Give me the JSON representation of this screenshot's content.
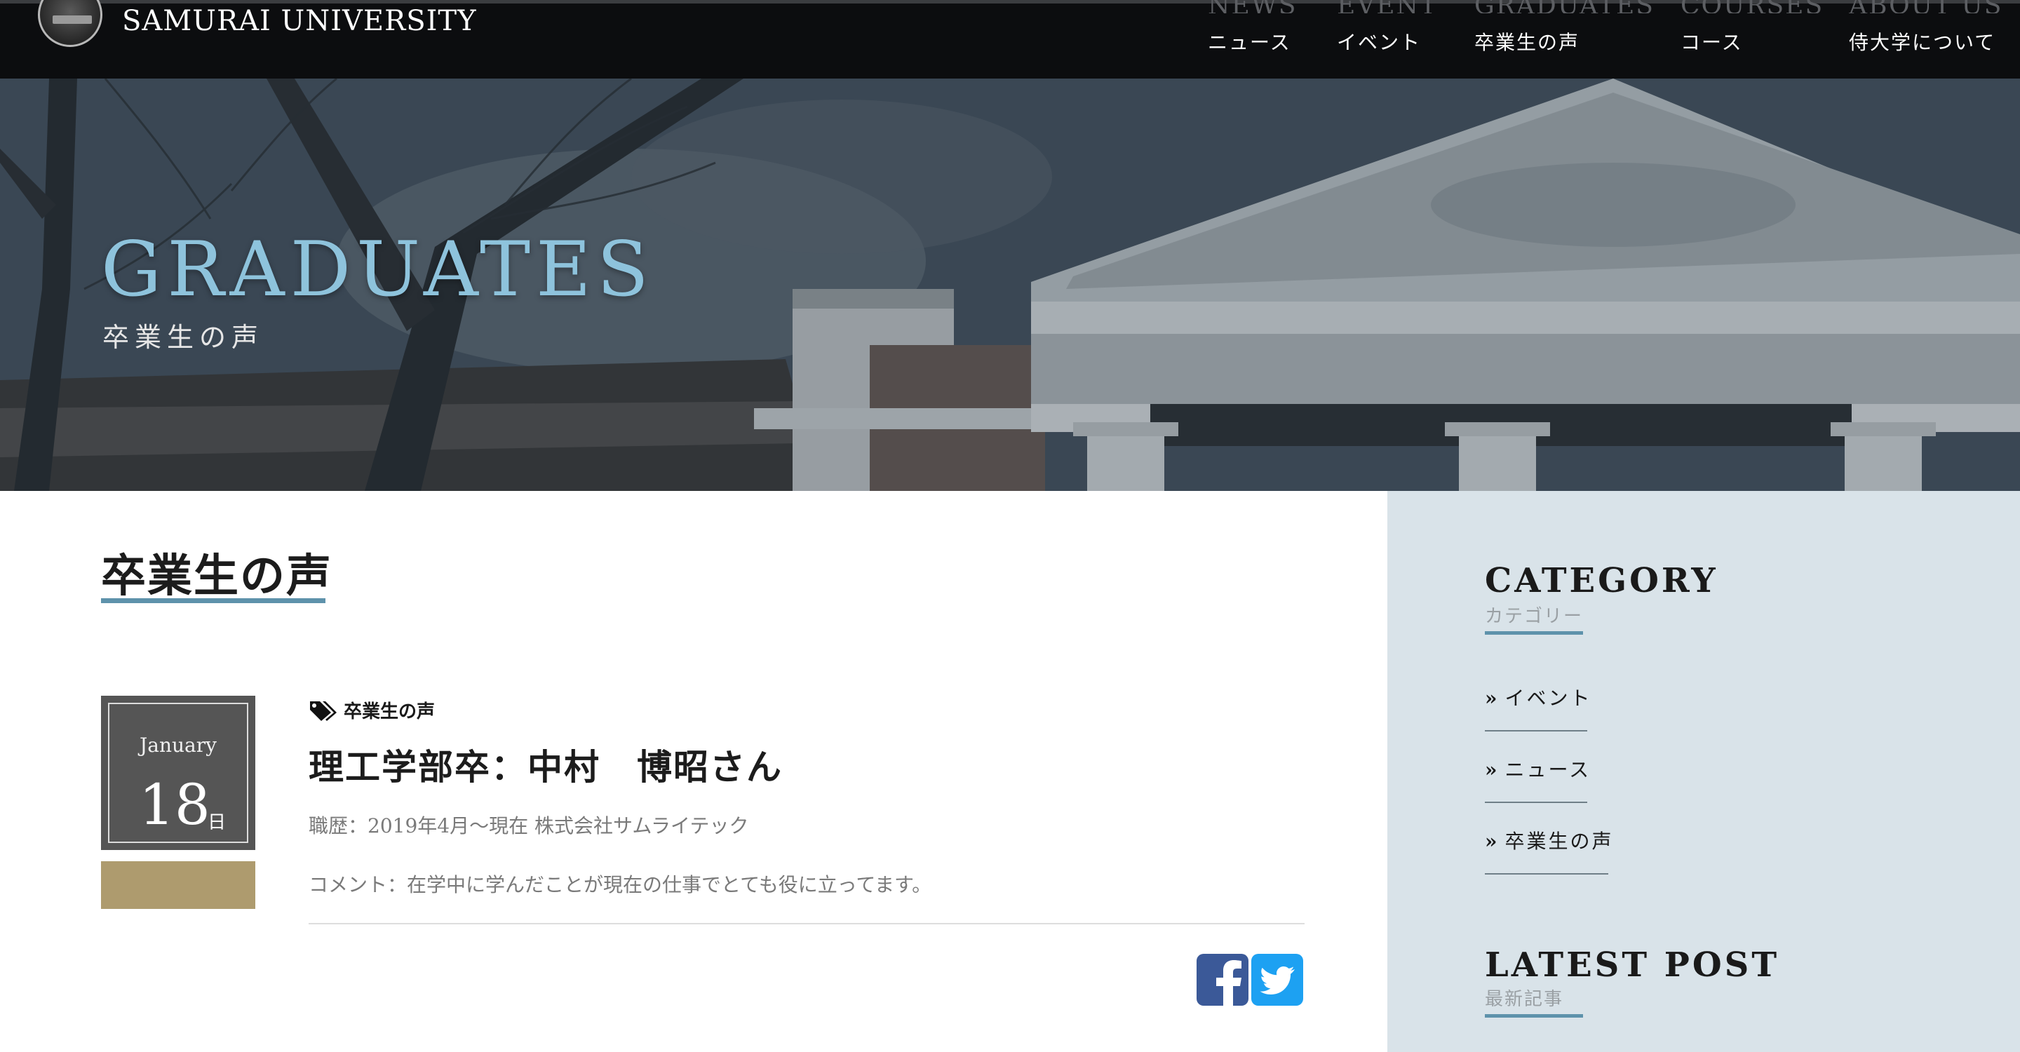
{
  "header": {
    "site_name": "SAMURAI UNIVERSITY",
    "nav": [
      {
        "en": "NEWS",
        "ja": "ニュース"
      },
      {
        "en": "EVENT",
        "ja": "イベント"
      },
      {
        "en": "GRADUATES",
        "ja": "卒業生の声"
      },
      {
        "en": "COURSES",
        "ja": "コース"
      },
      {
        "en": "ABOUT US",
        "ja": "侍大学について"
      }
    ]
  },
  "hero": {
    "title": "GRADUATES",
    "subtitle": "卒業生の声"
  },
  "main": {
    "section_title": "卒業生の声",
    "post": {
      "month": "January",
      "day": "18",
      "day_unit": "日",
      "tag": "卒業生の声",
      "title": "理工学部卒：中村　博昭さん",
      "career": "職歴：2019年4月〜現在 株式会社サムライテック",
      "comment": "コメント：在学中に学んだことが現在の仕事でとても役に立ってます。",
      "share": [
        "facebook-icon",
        "twitter-icon"
      ]
    }
  },
  "sidebar": {
    "category": {
      "title": "CATEGORY",
      "subtitle": "カテゴリー",
      "items": [
        "イベント",
        "ニュース",
        "卒業生の声"
      ],
      "chevron": "»"
    },
    "latest": {
      "title": "LATEST POST",
      "subtitle": "最新記事"
    }
  },
  "colors": {
    "accent": "#5e92ab",
    "hero_title": "#8ec3dc",
    "date_box": "#555555",
    "date_bar": "#ae9b6e",
    "sidebar_bg": "#d9e3e9",
    "facebook": "#3b5998",
    "twitter": "#1da1f2"
  }
}
